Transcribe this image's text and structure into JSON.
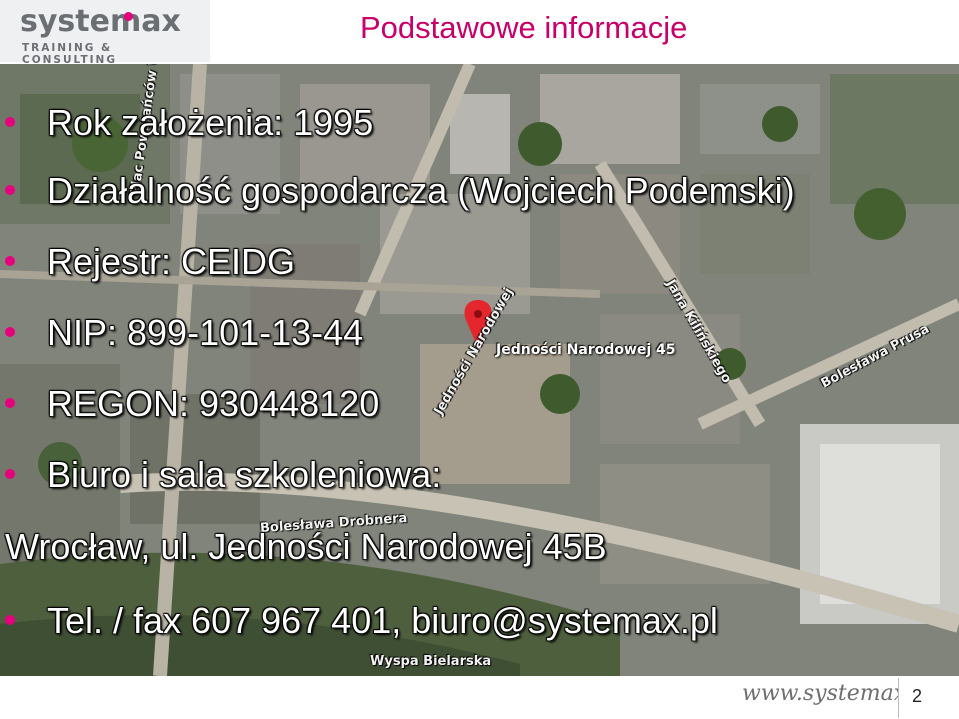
{
  "header": {
    "logo_word": "systemax",
    "logo_tagline": "TRAINING & CONSULTING",
    "title": "Podstawowe informacje"
  },
  "bullets": [
    {
      "text": "Rok założenia: 1995",
      "bullet": true
    },
    {
      "text": "Działalność gospodarcza (Wojciech Podemski)",
      "bullet": true
    },
    {
      "text": "Rejestr: CEIDG",
      "bullet": true
    },
    {
      "text": "NIP: 899-101-13-44",
      "bullet": true
    },
    {
      "text": "REGON: 930448120",
      "bullet": true
    },
    {
      "text": "Biuro i sala szkoleniowa:",
      "bullet": true
    },
    {
      "text": "Wrocław, ul. Jedności Narodowej 45B",
      "bullet": false
    },
    {
      "text": "Tel. / fax 607 967 401, biuro@systemax.pl",
      "bullet": true
    }
  ],
  "map": {
    "pin_label": "Jedności Narodowej 45",
    "streets": [
      "Jedności Narodowej",
      "Jana Kilińskiego",
      "Bolesława Prusa",
      "Bolesława Drobnera",
      "Wyspa Bielarska",
      "Plac Powstańców Wielkopolskich"
    ]
  },
  "footer": {
    "url": "www.systemax.pl",
    "page_number": "2"
  },
  "colors": {
    "accent": "#e6007e",
    "title": "#c8006a",
    "logo_gray": "#6b6f74"
  }
}
